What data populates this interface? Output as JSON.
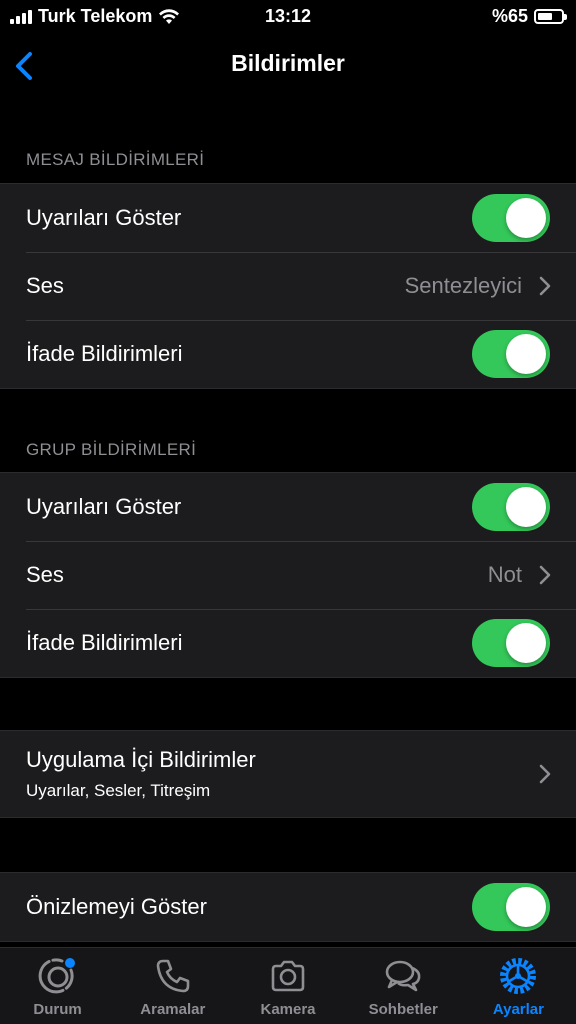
{
  "status_bar": {
    "carrier": "Turk Telekom",
    "time": "13:12",
    "battery": "%65",
    "battery_level": 0.65
  },
  "nav": {
    "title": "Bildirimler",
    "back_icon": "chevron-left-icon"
  },
  "message_notifications": {
    "header": "MESAJ BİLDİRİMLERİ",
    "show_alerts_label": "Uyarıları Göster",
    "show_alerts_on": true,
    "sound_label": "Ses",
    "sound_value": "Sentezleyici",
    "reaction_label": "İfade Bildirimleri",
    "reaction_on": true
  },
  "group_notifications": {
    "header": "GRUP BİLDİRİMLERİ",
    "show_alerts_label": "Uyarıları Göster",
    "show_alerts_on": true,
    "sound_label": "Ses",
    "sound_value": "Not",
    "reaction_label": "İfade Bildirimleri",
    "reaction_on": true
  },
  "in_app": {
    "label": "Uygulama İçi Bildirimler",
    "subtitle": "Uyarılar, Sesler, Titreşim"
  },
  "preview": {
    "label": "Önizlemeyi Göster",
    "on": true
  },
  "tab_bar": {
    "tabs": [
      {
        "label": "Durum",
        "icon": "status-icon"
      },
      {
        "label": "Aramalar",
        "icon": "phone-icon"
      },
      {
        "label": "Kamera",
        "icon": "camera-icon"
      },
      {
        "label": "Sohbetler",
        "icon": "chat-bubbles-icon"
      },
      {
        "label": "Ayarlar",
        "icon": "gear-icon"
      }
    ],
    "active": "Ayarlar"
  },
  "colors": {
    "toggle_on": "#34c759",
    "accent": "#0a84ff",
    "cell_bg": "#1c1c1e",
    "secondary_text": "#8e8e93"
  }
}
